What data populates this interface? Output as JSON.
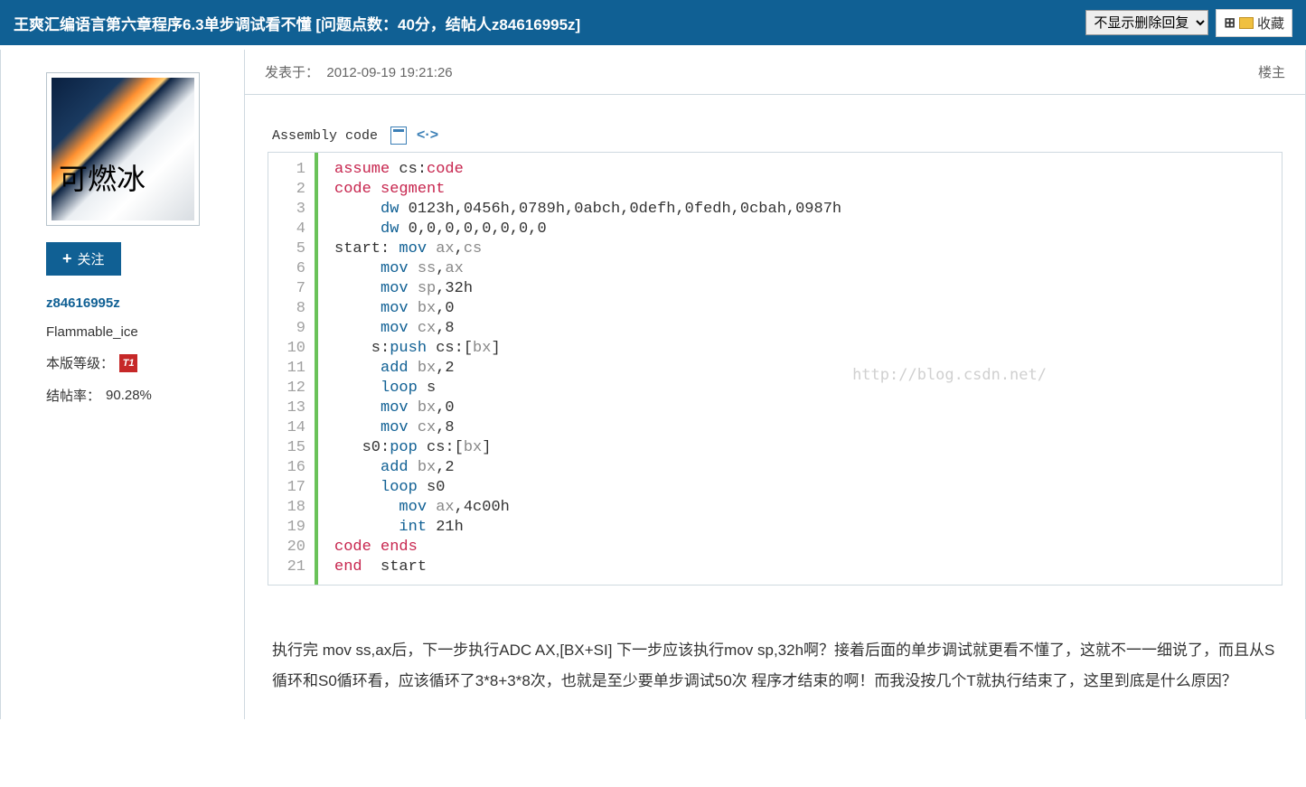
{
  "header": {
    "title": "王爽汇编语言第六章程序6.3单步调试看不懂 [问题点数：40分，结帖人z84616995z]",
    "filter_option": "不显示删除回复",
    "favorite": "收藏"
  },
  "sidebar": {
    "avatar_text": "可燃冰",
    "follow_label": "关注",
    "username": "z84616995z",
    "displayname": "Flammable_ice",
    "level_label": "本版等级：",
    "level_badge": "T1",
    "closerate_label": "结帖率：",
    "closerate_value": "90.28%"
  },
  "post": {
    "posted_at_label": "发表于：",
    "posted_at": "2012-09-19 19:21:26",
    "floor": "楼主",
    "codehead_label": "Assembly code",
    "watermark": "http://blog.csdn.net/",
    "code_lines": [
      [
        [
          "kw-def",
          "assume"
        ],
        [
          "",
          " cs:"
        ],
        [
          "kw-def",
          "code"
        ]
      ],
      [
        [
          "kw-def",
          "code"
        ],
        [
          "",
          " "
        ],
        [
          "kw-def",
          "segment"
        ]
      ],
      [
        [
          "",
          "     "
        ],
        [
          "kw-inst",
          "dw"
        ],
        [
          "",
          " 0123h,0456h,0789h,0abch,0defh,0fedh,0cbah,0987h"
        ]
      ],
      [
        [
          "",
          "     "
        ],
        [
          "kw-inst",
          "dw"
        ],
        [
          "",
          " 0,0,0,0,0,0,0,0"
        ]
      ],
      [
        [
          "",
          "start: "
        ],
        [
          "kw-inst",
          "mov"
        ],
        [
          "",
          " "
        ],
        [
          "reg",
          "ax"
        ],
        [
          "",
          ","
        ],
        [
          "reg",
          "cs"
        ]
      ],
      [
        [
          "",
          "     "
        ],
        [
          "kw-inst",
          "mov"
        ],
        [
          "",
          " "
        ],
        [
          "reg",
          "ss"
        ],
        [
          "",
          ","
        ],
        [
          "reg",
          "ax"
        ]
      ],
      [
        [
          "",
          "     "
        ],
        [
          "kw-inst",
          "mov"
        ],
        [
          "",
          " "
        ],
        [
          "reg",
          "sp"
        ],
        [
          "",
          ",32h"
        ]
      ],
      [
        [
          "",
          "     "
        ],
        [
          "kw-inst",
          "mov"
        ],
        [
          "",
          " "
        ],
        [
          "reg",
          "bx"
        ],
        [
          "",
          ",0"
        ]
      ],
      [
        [
          "",
          "     "
        ],
        [
          "kw-inst",
          "mov"
        ],
        [
          "",
          " "
        ],
        [
          "reg",
          "cx"
        ],
        [
          "",
          ",8"
        ]
      ],
      [
        [
          "",
          "    s:"
        ],
        [
          "kw-inst",
          "push"
        ],
        [
          "",
          " cs:["
        ],
        [
          "reg",
          "bx"
        ],
        [
          "",
          "]"
        ]
      ],
      [
        [
          "",
          "     "
        ],
        [
          "kw-inst",
          "add"
        ],
        [
          "",
          " "
        ],
        [
          "reg",
          "bx"
        ],
        [
          "",
          ",2"
        ]
      ],
      [
        [
          "",
          "     "
        ],
        [
          "kw-inst",
          "loop"
        ],
        [
          "",
          " s"
        ]
      ],
      [
        [
          "",
          "     "
        ],
        [
          "kw-inst",
          "mov"
        ],
        [
          "",
          " "
        ],
        [
          "reg",
          "bx"
        ],
        [
          "",
          ",0"
        ]
      ],
      [
        [
          "",
          "     "
        ],
        [
          "kw-inst",
          "mov"
        ],
        [
          "",
          " "
        ],
        [
          "reg",
          "cx"
        ],
        [
          "",
          ",8"
        ]
      ],
      [
        [
          "",
          "   s0:"
        ],
        [
          "kw-inst",
          "pop"
        ],
        [
          "",
          " cs:["
        ],
        [
          "reg",
          "bx"
        ],
        [
          "",
          "]"
        ]
      ],
      [
        [
          "",
          "     "
        ],
        [
          "kw-inst",
          "add"
        ],
        [
          "",
          " "
        ],
        [
          "reg",
          "bx"
        ],
        [
          "",
          ",2"
        ]
      ],
      [
        [
          "",
          "     "
        ],
        [
          "kw-inst",
          "loop"
        ],
        [
          "",
          " s0"
        ]
      ],
      [
        [
          "",
          "       "
        ],
        [
          "kw-inst",
          "mov"
        ],
        [
          "",
          " "
        ],
        [
          "reg",
          "ax"
        ],
        [
          "",
          ",4c00h"
        ]
      ],
      [
        [
          "",
          "       "
        ],
        [
          "kw-inst",
          "int"
        ],
        [
          "",
          " 21h"
        ]
      ],
      [
        [
          "kw-def",
          "code"
        ],
        [
          "",
          " "
        ],
        [
          "kw-def",
          "ends"
        ]
      ],
      [
        [
          "kw-def",
          "end"
        ],
        [
          "",
          "  start"
        ]
      ]
    ],
    "body_text": "执行完 mov ss,ax后，下一步执行ADC  AX,[BX+SI] 下一步应该执行mov sp,32h啊？接着后面的单步调试就更看不懂了，这就不一一细说了，而且从S循环和S0循环看，应该循环了3*8+3*8次，也就是至少要单步调试50次 程序才结束的啊！而我没按几个T就执行结束了，这里到底是什么原因？"
  }
}
